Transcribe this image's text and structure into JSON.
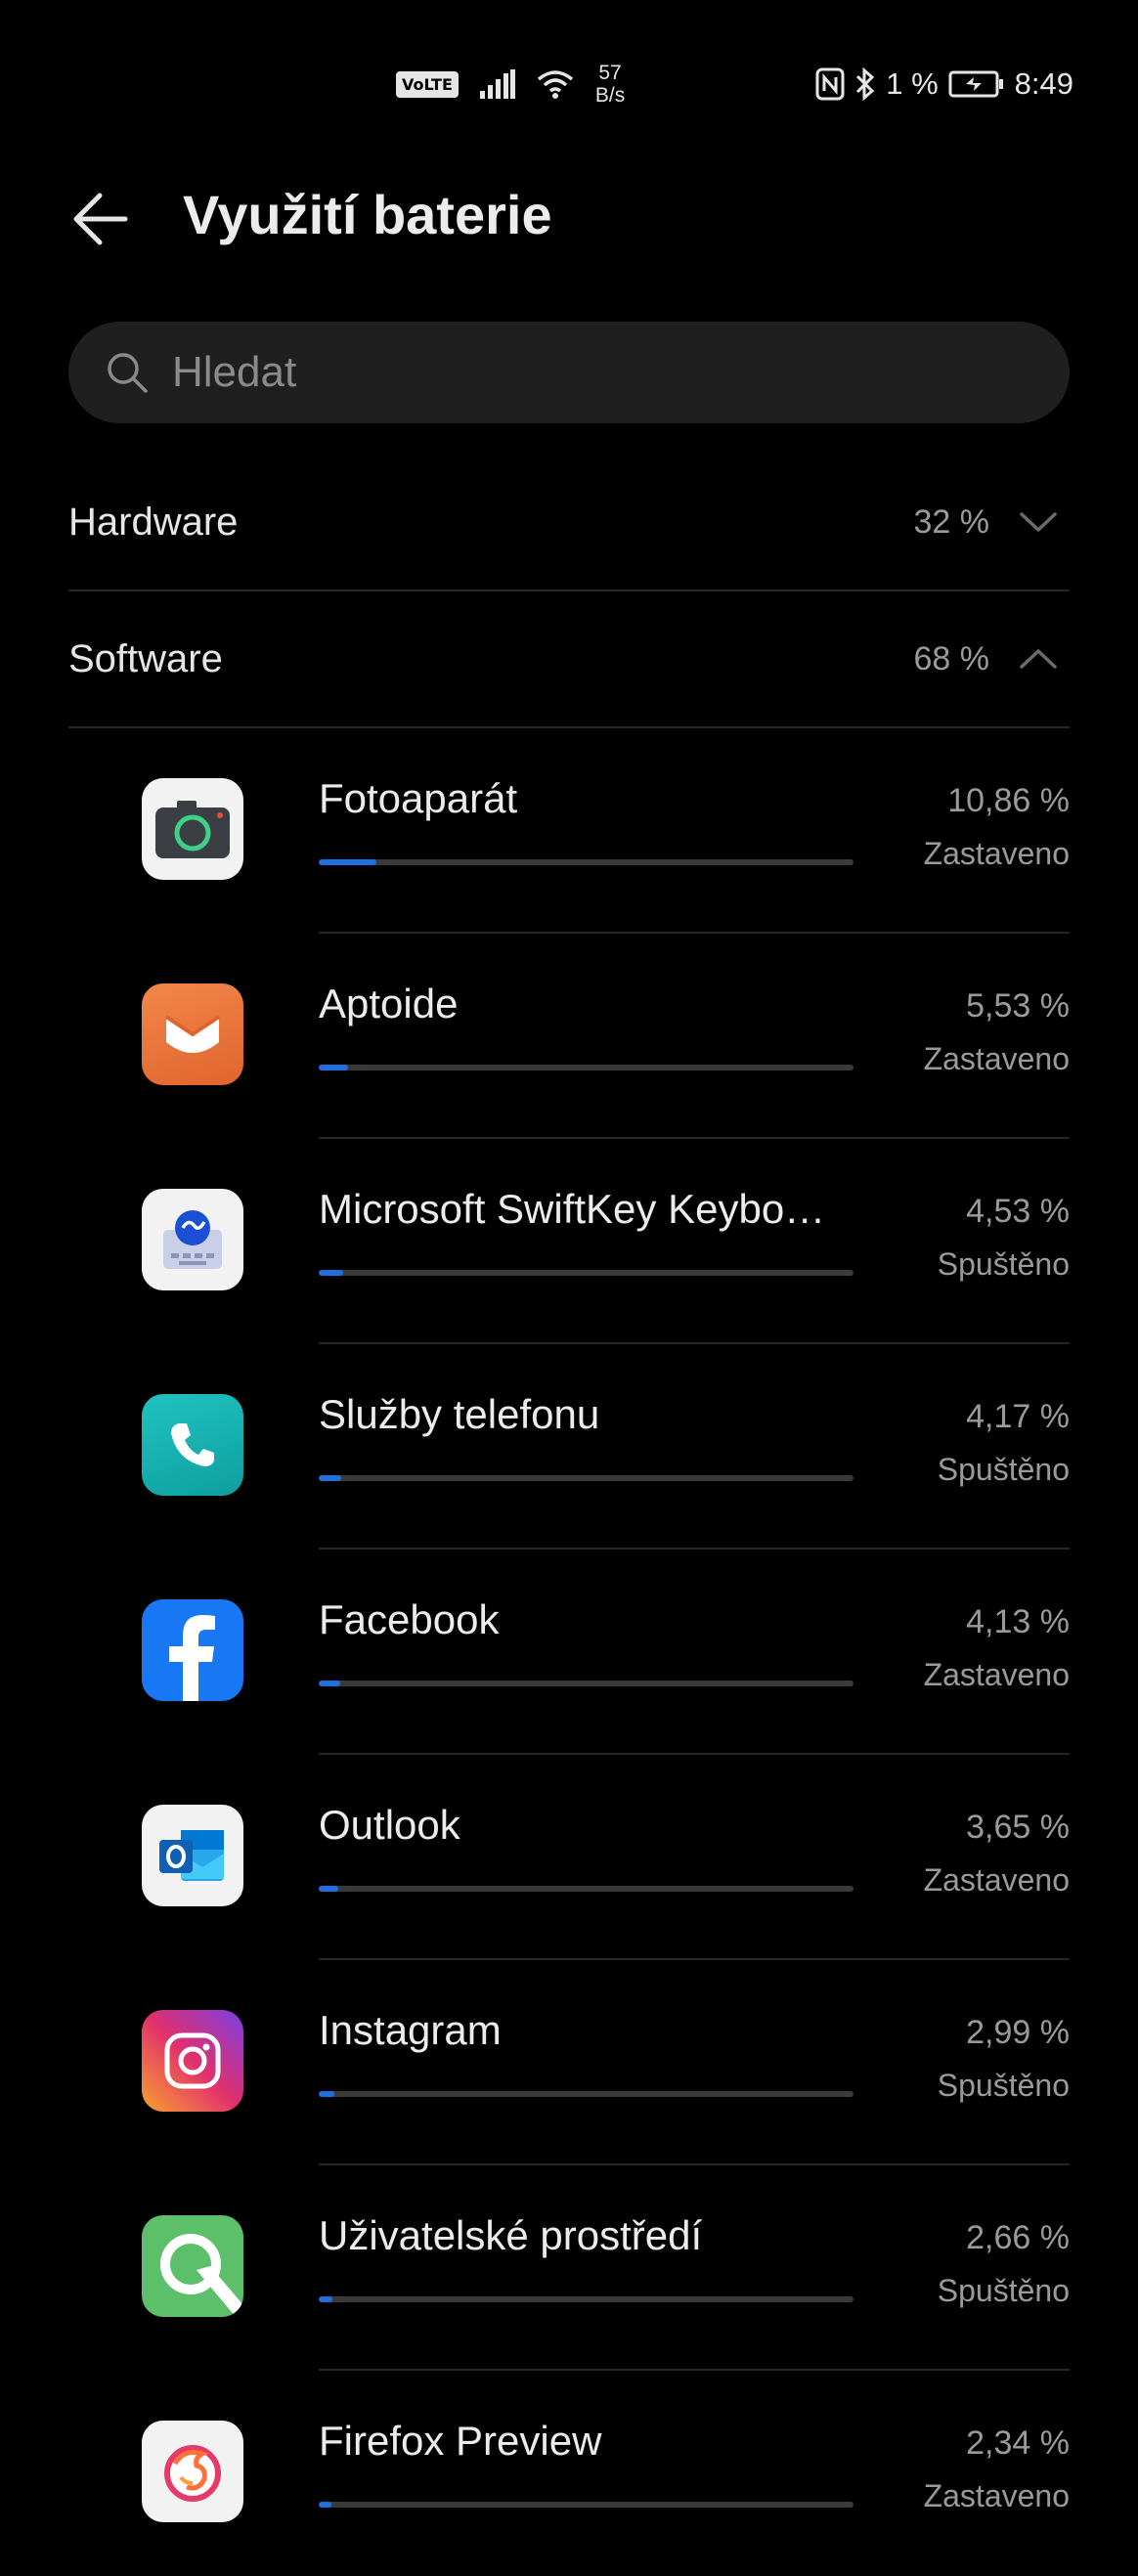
{
  "status_bar": {
    "volte": "VoLTE",
    "speed_value": "57",
    "speed_unit": "B/s",
    "battery_percent": "1 %",
    "time": "8:49"
  },
  "header": {
    "title": "Využití baterie"
  },
  "search": {
    "placeholder": "Hledat"
  },
  "categories": [
    {
      "label": "Hardware",
      "value": "32 %",
      "expanded": false
    },
    {
      "label": "Software",
      "value": "68 %",
      "expanded": true
    }
  ],
  "apps": [
    {
      "name": "Fotoaparát",
      "percent": "10,86 %",
      "status": "Zastaveno",
      "usage": 10.86,
      "icon": "camera-app-icon"
    },
    {
      "name": "Aptoide",
      "percent": "5,53 %",
      "status": "Zastaveno",
      "usage": 5.53,
      "icon": "aptoide-app-icon"
    },
    {
      "name": "Microsoft SwiftKey Keybo…",
      "percent": "4,53 %",
      "status": "Spuštěno",
      "usage": 4.53,
      "icon": "swiftkey-app-icon"
    },
    {
      "name": "Služby telefonu",
      "percent": "4,17 %",
      "status": "Spuštěno",
      "usage": 4.17,
      "icon": "phone-services-app-icon"
    },
    {
      "name": "Facebook",
      "percent": "4,13 %",
      "status": "Zastaveno",
      "usage": 4.13,
      "icon": "facebook-app-icon"
    },
    {
      "name": "Outlook",
      "percent": "3,65 %",
      "status": "Zastaveno",
      "usage": 3.65,
      "icon": "outlook-app-icon"
    },
    {
      "name": "Instagram",
      "percent": "2,99 %",
      "status": "Spuštěno",
      "usage": 2.99,
      "icon": "instagram-app-icon"
    },
    {
      "name": "Uživatelské prostředí",
      "percent": "2,66 %",
      "status": "Spuštěno",
      "usage": 2.66,
      "icon": "system-ui-app-icon"
    },
    {
      "name": "Firefox Preview",
      "percent": "2,34 %",
      "status": "Zastaveno",
      "usage": 2.34,
      "icon": "firefox-preview-app-icon"
    }
  ],
  "colors": {
    "background": "#000000",
    "accent": "#1e6fe0",
    "search_bg": "#1f1f1f",
    "divider": "#262626"
  }
}
